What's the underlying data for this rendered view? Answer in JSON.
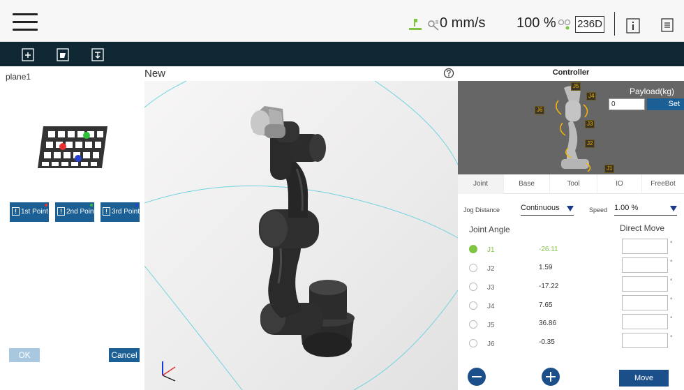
{
  "topbar": {
    "speed_text": "0 mm/s",
    "percent_text": "100 %",
    "badge_text": "236D"
  },
  "left_panel": {
    "plane_name": "plane1",
    "points": [
      {
        "label": "1st Point",
        "dot_color": "#e83030"
      },
      {
        "label": "2nd Point",
        "dot_color": "#2fc23a"
      },
      {
        "label": "3rd Point",
        "dot_color": "#2a3fd0"
      }
    ],
    "ok_label": "OK",
    "cancel_label": "Cancel"
  },
  "viewport": {
    "title": "New"
  },
  "controller": {
    "title": "Controller",
    "payload_label": "Payload(kg)",
    "payload_value": "0",
    "payload_set_label": "Set",
    "preview_joint_tags": [
      "J5",
      "J4",
      "J6",
      "J3",
      "J2",
      "J1"
    ],
    "tabs": [
      "Joint",
      "Base",
      "Tool",
      "IO",
      "FreeBot"
    ],
    "active_tab": "Joint",
    "jog_distance_label": "Jog Distance",
    "jog_distance_value": "Continuous",
    "speed_label": "Speed",
    "speed_value": "1.00 %",
    "joint_angle_label": "Joint Angle",
    "direct_move_label": "Direct Move",
    "joints": [
      {
        "name": "J1",
        "value": "-26.11",
        "selected": true
      },
      {
        "name": "J2",
        "value": "1.59",
        "selected": false
      },
      {
        "name": "J3",
        "value": "-17.22",
        "selected": false
      },
      {
        "name": "J4",
        "value": "7.65",
        "selected": false
      },
      {
        "name": "J5",
        "value": "36.86",
        "selected": false
      },
      {
        "name": "J6",
        "value": "-0.35",
        "selected": false
      }
    ],
    "degree_symbol": "°",
    "move_label": "Move"
  },
  "colors": {
    "accent": "#1b5f94",
    "toolbar_bg": "#0f2733",
    "active_green": "#7fc343",
    "joint_tag": "#f6b800"
  }
}
